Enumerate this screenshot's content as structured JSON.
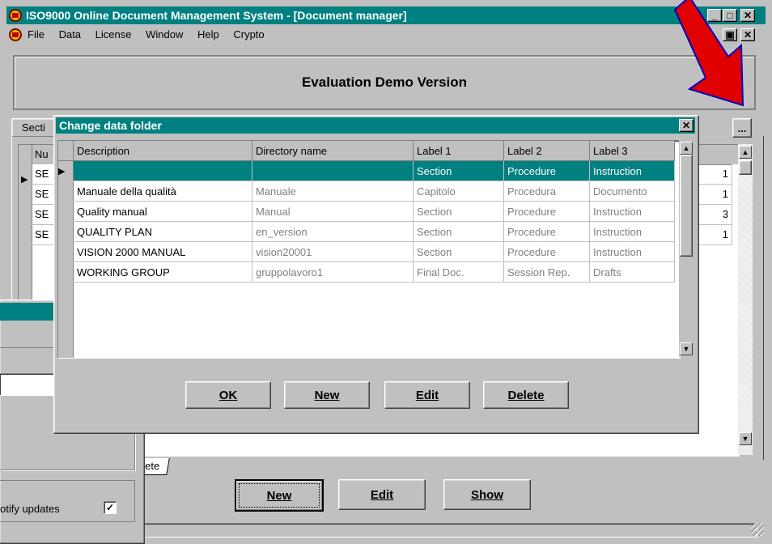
{
  "app": {
    "title": "ISO9000 Online Document Management System - [Document manager]",
    "menu": [
      "File",
      "Data",
      "License",
      "Window",
      "Help",
      "Crypto"
    ],
    "banner": "Evaluation Demo Version",
    "tab_fragment": "Secti",
    "bottom_tab_fragment": "ete",
    "ellipsis_label": "...",
    "bottom_buttons": {
      "new": "New",
      "edit": "Edit",
      "show": "Show"
    }
  },
  "background_grid": {
    "header_fragment": "Nu",
    "rows": [
      {
        "left": "SE",
        "right": "1"
      },
      {
        "left": "SE",
        "right": "1"
      },
      {
        "left": "SE",
        "right": "3"
      },
      {
        "left": "SE",
        "right": "1"
      }
    ]
  },
  "dialog": {
    "title": "Change data folder",
    "columns": [
      "Description",
      "Directory name",
      "Label 1",
      "Label 2",
      "Label 3"
    ],
    "rows": [
      {
        "description": "",
        "directory": "",
        "label1": "Section",
        "label2": "Procedure",
        "label3": "Instruction"
      },
      {
        "description": "Manuale della qualità",
        "directory": "Manuale",
        "label1": "Capitolo",
        "label2": "Procedura",
        "label3": "Documento"
      },
      {
        "description": "Quality manual",
        "directory": "Manual",
        "label1": "Section",
        "label2": "Procedure",
        "label3": "Instruction"
      },
      {
        "description": "QUALITY PLAN",
        "directory": "en_version",
        "label1": "Section",
        "label2": "Procedure",
        "label3": "Instruction"
      },
      {
        "description": "VISION 2000 MANUAL",
        "directory": "vision20001",
        "label1": "Section",
        "label2": "Procedure",
        "label3": "Instruction"
      },
      {
        "description": "WORKING GROUP",
        "directory": "gruppolavoro1",
        "label1": "Final Doc.",
        "label2": "Session Rep.",
        "label3": "Drafts"
      }
    ],
    "buttons": {
      "ok": "OK",
      "new": "New",
      "edit": "Edit",
      "delete": "Delete"
    }
  },
  "left_dialog": {
    "notify_label": "otify updates",
    "notify_checked": true
  },
  "colors": {
    "titlebar": "#008080",
    "selection": "#008080",
    "arrow": "#e00000",
    "face": "#c0c0c0"
  }
}
